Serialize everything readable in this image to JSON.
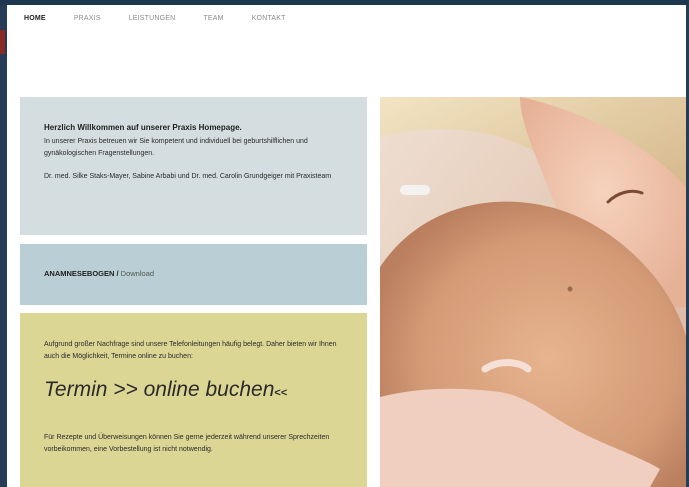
{
  "nav": {
    "items": [
      "HOME",
      "PRAXIS",
      "LEISTUNGEN",
      "TEAM",
      "KONTAKT"
    ]
  },
  "welcome": {
    "title": "Herzlich Willkommen auf unserer Praxis Homepage.",
    "text1": "In unserer Praxis betreuen wir Sie kompetent und individuell bei geburtshilflichen und gynäkologischen Fragenstellungen.",
    "text2": "Dr. med. Silke Staks-Mayer, Sabine Arbabi und Dr. med. Carolin Grundgeiger mit Praxisteam"
  },
  "download": {
    "label": "ANAMNESEBOGEN /",
    "link": " Download"
  },
  "termin": {
    "intro": "Aufgrund großer Nachfrage sind unsere Telefonleitungen häufig belegt. Daher bieten wir Ihnen auch die Möglichkeit, Termine online zu buchen:",
    "link_main": "Termin >> online buchen",
    "link_tail": "<<",
    "note": "Für Rezepte und Überweisungen können Sie gerne jederzeit während unserer Sprechzeiten vorbeikommen, eine Vorbestellung ist nicht notwendig."
  },
  "colors": {
    "welcome_bg": "#d4dde0",
    "download_bg": "#b9cfd5",
    "termin_bg": "#dcd695",
    "frame": "#1e3750"
  }
}
